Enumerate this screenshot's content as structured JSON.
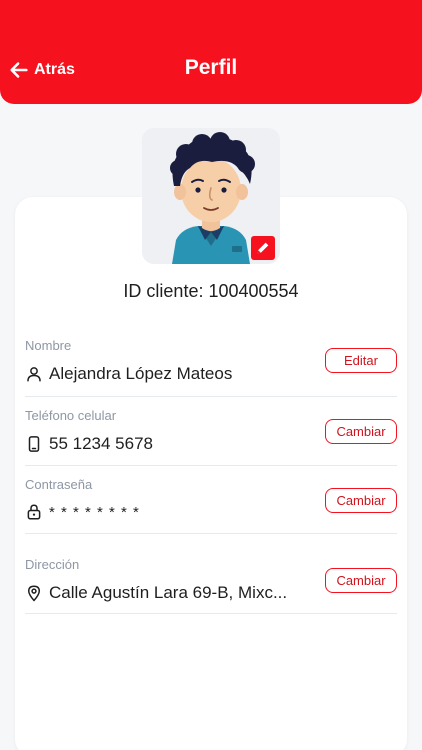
{
  "header": {
    "back_label": "Atrás",
    "title": "Perfil"
  },
  "profile": {
    "client_id_text": "ID cliente: 100400554"
  },
  "fields": {
    "name": {
      "label": "Nombre",
      "value": "Alejandra López Mateos",
      "action": "Editar"
    },
    "phone": {
      "label": "Teléfono celular",
      "value": "55 1234 5678",
      "action": "Cambiar"
    },
    "password": {
      "label": "Contraseña",
      "value": "* * * * * * * *",
      "action": "Cambiar"
    },
    "address": {
      "label": "Dirección",
      "value": "Calle Agustín Lara 69-B, Mixc...",
      "action": "Cambiar"
    }
  },
  "colors": {
    "brand": "#f5111e",
    "label_gray": "#8e97a4",
    "background": "#f6f7f9"
  },
  "icons": {
    "back": "arrow-left-icon",
    "edit_photo": "pencil-icon",
    "name": "user-icon",
    "phone": "phone-icon",
    "password": "lock-icon",
    "address": "location-pin-icon"
  }
}
